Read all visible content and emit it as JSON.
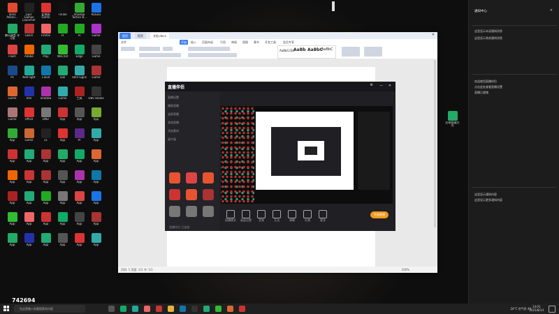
{
  "desktop": {
    "icons": [
      {
        "label": "Tasks Advan...",
        "color": "#e04a2f",
        "icon": "app-icon"
      },
      {
        "label": "Epic Games Launcher",
        "color": "#222",
        "icon": "epic-icon"
      },
      {
        "label": "此电脑 Game",
        "color": "#d33",
        "icon": "app-icon"
      },
      {
        "label": "TikTok",
        "color": "#111",
        "icon": "tiktok-icon"
      },
      {
        "label": "Shadow Tactics B...",
        "color": "#3a3",
        "icon": "app-icon"
      },
      {
        "label": "KuGou",
        "color": "#1a74e8",
        "icon": "kugou-icon"
      },
      {
        "label": "腾讯课堂 学习版",
        "color": "#2a6",
        "icon": "app-icon"
      },
      {
        "label": "Gears",
        "color": "#b33",
        "icon": "app-icon"
      },
      {
        "label": "Firefox",
        "color": "#e66",
        "icon": "firefox-icon"
      },
      {
        "label": "H",
        "color": "#2a2",
        "icon": "app-icon"
      },
      {
        "label": "H",
        "color": "#2a2",
        "icon": "app-icon"
      },
      {
        "label": "Game",
        "color": "#a3c",
        "icon": "app-icon"
      },
      {
        "label": "Flash",
        "color": "#d44",
        "icon": "app-icon"
      },
      {
        "label": "Adobe",
        "color": "#e60",
        "icon": "app-icon"
      },
      {
        "label": "Play",
        "color": "#2a7",
        "icon": "app-icon"
      },
      {
        "label": "WeChat",
        "color": "#3b3",
        "icon": "wechat-icon"
      },
      {
        "label": "Edge",
        "color": "#1a6",
        "icon": "edge-icon"
      },
      {
        "label": "Game",
        "color": "#444",
        "icon": "app-icon"
      },
      {
        "label": "Ps",
        "color": "#1a4a8a",
        "icon": "photoshop-icon"
      },
      {
        "label": "NetFlight",
        "color": "#2a9",
        "icon": "app-icon"
      },
      {
        "label": "Cloud",
        "color": "#17a",
        "icon": "app-icon"
      },
      {
        "label": "Tool",
        "color": "#2a7",
        "icon": "app-icon"
      },
      {
        "label": "Stell Signs",
        "color": "#3aa",
        "icon": "app-icon"
      },
      {
        "label": "Game",
        "color": "#a33",
        "icon": "app-icon"
      },
      {
        "label": "Game",
        "color": "#d63",
        "icon": "app-icon"
      },
      {
        "label": "Ann",
        "color": "#23a",
        "icon": "app-icon"
      },
      {
        "label": "Shadow",
        "color": "#a3a",
        "icon": "app-icon"
      },
      {
        "label": "Game",
        "color": "#3aa",
        "icon": "app-icon"
      },
      {
        "label": "工具",
        "color": "#a22",
        "icon": "app-icon"
      },
      {
        "label": "OBS Studio",
        "color": "#333",
        "icon": "obs-icon"
      },
      {
        "label": "Game",
        "color": "#a77",
        "icon": "app-icon"
      },
      {
        "label": "Office",
        "color": "#d33",
        "icon": "app-icon"
      },
      {
        "label": "DMZ",
        "color": "#777",
        "icon": "app-icon"
      },
      {
        "label": "App",
        "color": "#c33",
        "icon": "app-icon"
      },
      {
        "label": "App",
        "color": "#555",
        "icon": "app-icon"
      },
      {
        "label": "App",
        "color": "#7a3",
        "icon": "app-icon"
      },
      {
        "label": "App",
        "color": "#3a3",
        "icon": "app-icon"
      },
      {
        "label": "Game",
        "color": "#c63",
        "icon": "app-icon"
      },
      {
        "label": "21",
        "color": "#222",
        "icon": "app-icon"
      },
      {
        "label": "App",
        "color": "#d33",
        "icon": "app-icon"
      },
      {
        "label": "Pr",
        "color": "#5a2a8a",
        "icon": "premiere-icon"
      },
      {
        "label": "App",
        "color": "#3aa",
        "icon": "app-icon"
      },
      {
        "label": "App",
        "color": "#c33",
        "icon": "app-icon"
      },
      {
        "label": "App",
        "color": "#2a7",
        "icon": "app-icon"
      },
      {
        "label": "App",
        "color": "#a33",
        "icon": "app-icon"
      },
      {
        "label": "App",
        "color": "#2a6",
        "icon": "app-icon"
      },
      {
        "label": "App",
        "color": "#1a6",
        "icon": "app-icon"
      },
      {
        "label": "App",
        "color": "#d63",
        "icon": "app-icon"
      },
      {
        "label": "App",
        "color": "#e60",
        "icon": "app-icon"
      },
      {
        "label": "App",
        "color": "#c33",
        "icon": "app-icon"
      },
      {
        "label": "App",
        "color": "#a33",
        "icon": "app-icon"
      },
      {
        "label": "App",
        "color": "#555",
        "icon": "app-icon"
      },
      {
        "label": "App",
        "color": "#a3a",
        "icon": "app-icon"
      },
      {
        "label": "App",
        "color": "#17a",
        "icon": "app-icon"
      },
      {
        "label": "App",
        "color": "#a22",
        "icon": "app-icon"
      },
      {
        "label": "App",
        "color": "#2a7",
        "icon": "app-icon"
      },
      {
        "label": "App",
        "color": "#2a2",
        "icon": "app-icon"
      },
      {
        "label": "App",
        "color": "#777",
        "icon": "app-icon"
      },
      {
        "label": "App",
        "color": "#d44",
        "icon": "app-icon"
      },
      {
        "label": "App",
        "color": "#1a74e8",
        "icon": "app-icon"
      },
      {
        "label": "App",
        "color": "#3b3",
        "icon": "app-icon"
      },
      {
        "label": "App",
        "color": "#e66",
        "icon": "app-icon"
      },
      {
        "label": "App",
        "color": "#c33",
        "icon": "app-icon"
      },
      {
        "label": "App",
        "color": "#1a6",
        "icon": "app-icon"
      },
      {
        "label": "App",
        "color": "#444",
        "icon": "app-icon"
      },
      {
        "label": "App",
        "color": "#a33",
        "icon": "app-icon"
      },
      {
        "label": "App",
        "color": "#2a6",
        "icon": "app-icon"
      },
      {
        "label": "App",
        "color": "#23a",
        "icon": "app-icon"
      },
      {
        "label": "App",
        "color": "#2a7",
        "icon": "app-icon"
      },
      {
        "label": "App",
        "color": "#555",
        "icon": "app-icon"
      },
      {
        "label": "App",
        "color": "#d33",
        "icon": "app-icon"
      },
      {
        "label": "App",
        "color": "#3aa",
        "icon": "app-icon"
      }
    ],
    "right_icon": {
      "label": "右侧快捷方式",
      "color": "#2a6",
      "icon": "app-icon"
    }
  },
  "word": {
    "tabs": [
      "首页",
      "稻壳",
      "文档.docx"
    ],
    "menu": [
      "文件",
      "开始",
      "插入",
      "页面布局",
      "引用",
      "审阅",
      "视图",
      "章节",
      "开发工具",
      "会员专享"
    ],
    "styles": [
      "AaBbCcDd",
      "AaBb",
      "AaBbC",
      "AaBbC"
    ],
    "status_left": "页码: 1  页面: 1/1  节: 1/1",
    "status_right": "100%"
  },
  "recorder": {
    "title": "直播伴侣",
    "side_items": [
      "直播设置",
      "横屏直播",
      "竖屏直播",
      "游戏直播",
      "添加素材",
      "画中画",
      "摄像头",
      "窗口",
      "全屏",
      "文字",
      "图片"
    ],
    "bottom_controls": [
      "直播模式",
      "画面设置",
      "音频",
      "互动",
      "弹幕",
      "礼物",
      "更多",
      "设置",
      "分享"
    ],
    "start_button": "开始直播",
    "footer_text": "直播伴侣 已连接"
  },
  "notifications": {
    "header": "通知中心",
    "lines": [
      "这里显示未读通知消息",
      "这里显示其他通知消息",
      "欢迎使用直播伴侣",
      "点击此处查看直播设置",
      "直播已就绪",
      "这里显示通知内容",
      "这里显示更多通知内容"
    ]
  },
  "taskbar": {
    "search_placeholder": "在这里输入你要搜索的内容",
    "tray_text": "24°C 空气优 40",
    "time": "14:01",
    "date": "2021/8/14",
    "live_number": "742694"
  }
}
